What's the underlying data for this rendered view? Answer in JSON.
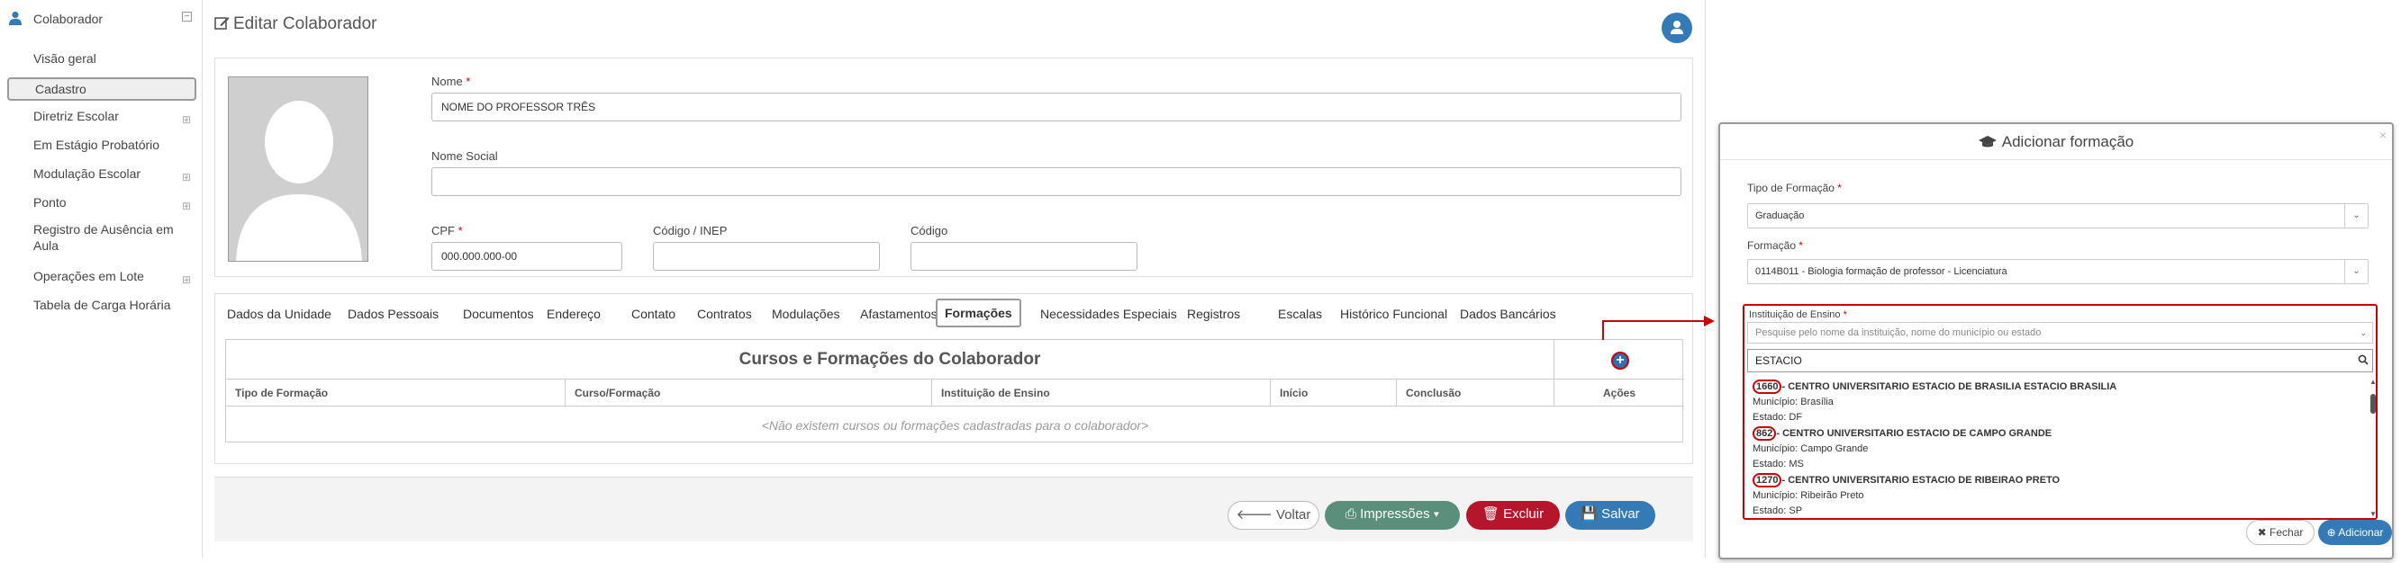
{
  "sidebar": {
    "title": "Colaborador",
    "collapse_glyph": "⊟",
    "items": [
      {
        "label": "Visão geral",
        "has_sub": false
      },
      {
        "label": "Cadastro",
        "has_sub": false
      },
      {
        "label": "Diretriz Escolar",
        "has_sub": true
      },
      {
        "label": "Em Estágio Probatório",
        "has_sub": false
      },
      {
        "label": "Modulação Escolar",
        "has_sub": true
      },
      {
        "label": "Ponto",
        "has_sub": true
      },
      {
        "label": "Registro de Ausência em Aula",
        "has_sub": false
      },
      {
        "label": "Operações em Lote",
        "has_sub": true
      },
      {
        "label": "Tabela de Carga Horária",
        "has_sub": false
      }
    ],
    "plus_glyph": "⊞"
  },
  "page": {
    "title": "Editar Colaborador"
  },
  "form": {
    "nome_label": "Nome",
    "nome_value": "NOME DO PROFESSOR TRÊS",
    "nome_social_label": "Nome Social",
    "nome_social_value": "",
    "cpf_label": "CPF",
    "cpf_value": "000.000.000-00",
    "inep_label": "Código / INEP",
    "inep_value": "",
    "codigo_label": "Código",
    "codigo_value": "",
    "required_mark": "*"
  },
  "tabs": [
    "Dados da Unidade",
    "Dados Pessoais",
    "Documentos",
    "Endereço",
    "Contato",
    "Contratos",
    "Modulações",
    "Afastamentos",
    "Formações",
    "Necessidades Especiais",
    "Registros",
    "Escalas",
    "Histórico Funcional",
    "Dados Bancários"
  ],
  "active_tab": "Formações",
  "grid": {
    "title": "Cursos e Formações do Colaborador",
    "add_glyph": "+",
    "columns": [
      "Tipo de Formação",
      "Curso/Formação",
      "Instituição de Ensino",
      "Início",
      "Conclusão",
      "Ações"
    ],
    "empty_message": "<Não existem cursos ou formações cadastradas para o colaborador>"
  },
  "actions": {
    "back": "Voltar",
    "print": "Impressões",
    "delete": "Excluir",
    "save": "Salvar"
  },
  "modal": {
    "title": "Adicionar formação",
    "close_glyph": "×",
    "tipo_label": "Tipo de Formação",
    "tipo_value": "Graduação",
    "formacao_label": "Formação",
    "formacao_value": "0114B011 - Biologia formação de professor - Licenciatura",
    "inst_label": "Instituição de Ensino",
    "inst_placeholder": "Pesquise pelo nome da instituição, nome do município ou estado",
    "search_value": "ESTACIO",
    "municipio_prefix": "Município:",
    "estado_prefix": "Estado:",
    "results": [
      {
        "code": "1660",
        "name": "- CENTRO UNIVERSITARIO ESTACIO DE BRASILIA ESTACIO BRASILIA",
        "municipio": "Brasília",
        "estado": "DF"
      },
      {
        "code": "862",
        "name": "- CENTRO UNIVERSITARIO ESTACIO DE CAMPO GRANDE",
        "municipio": "Campo Grande",
        "estado": "MS"
      },
      {
        "code": "1270",
        "name": "- CENTRO UNIVERSITARIO ESTACIO DE RIBEIRAO PRETO",
        "municipio": "Ribeirão Preto",
        "estado": "SP"
      }
    ],
    "fechar": "Fechar",
    "adicionar": "Adicionar"
  },
  "colors": {
    "primary": "#337ab7",
    "danger": "#b5162b",
    "print": "#5a8f7b",
    "highlight": "#cc0000"
  }
}
